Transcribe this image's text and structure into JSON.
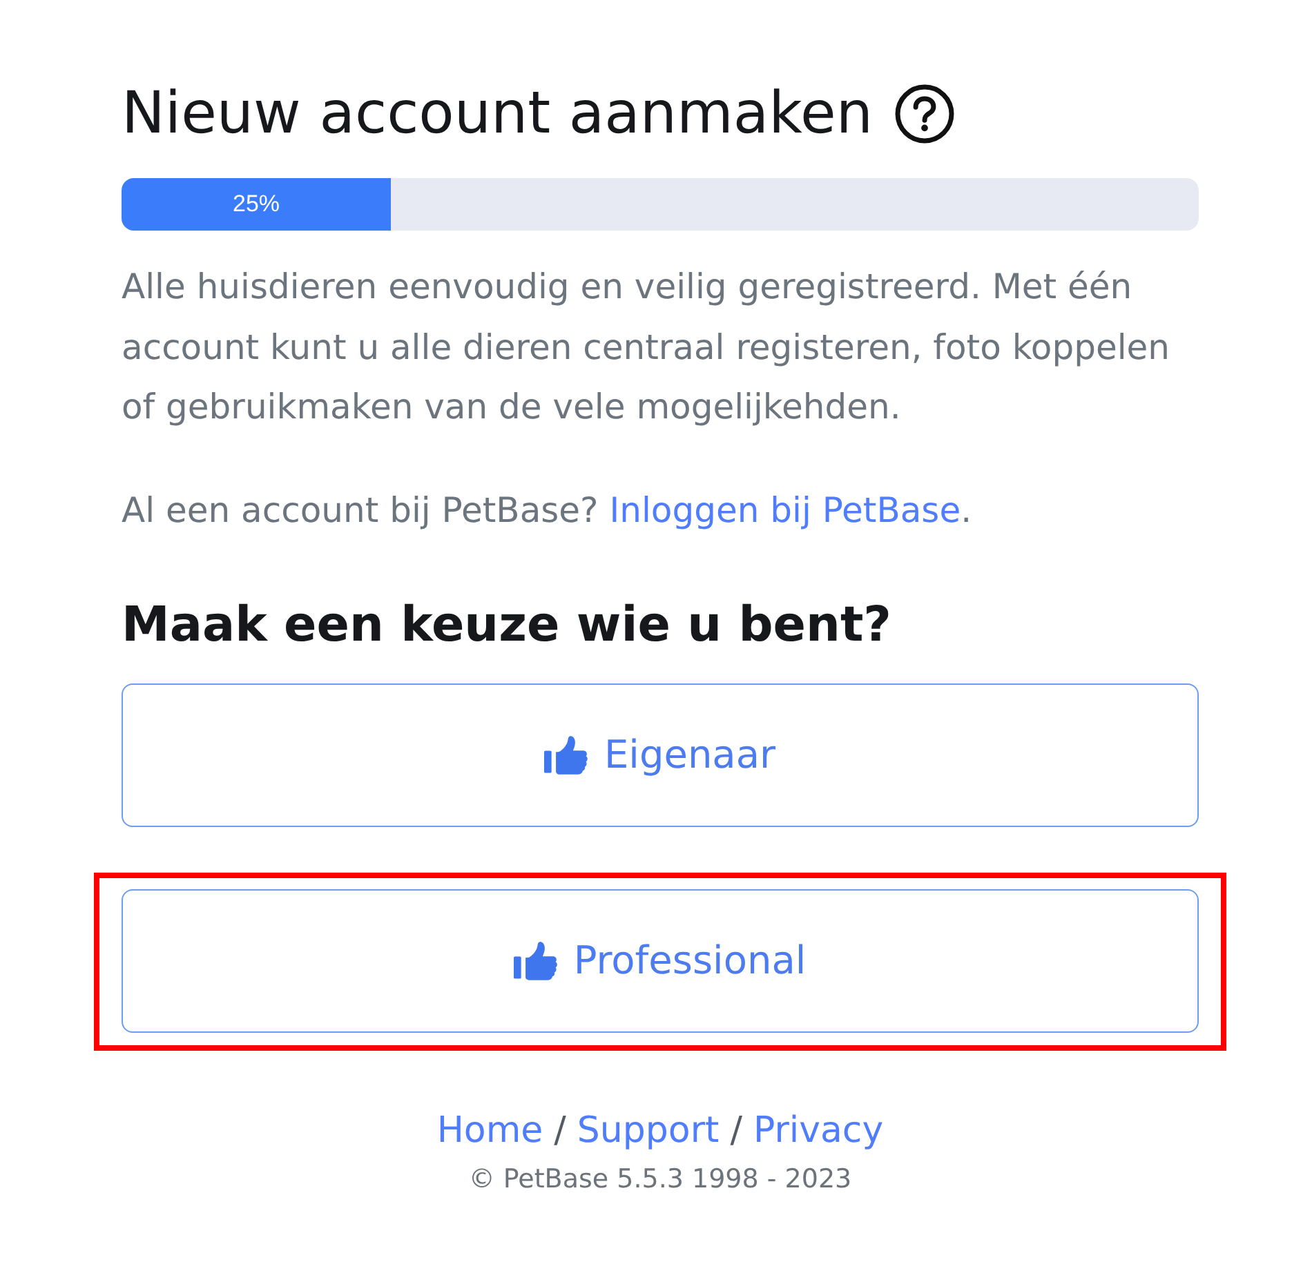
{
  "heading": {
    "title": "Nieuw account aanmaken"
  },
  "progress": {
    "level": 0.25,
    "label": "25%"
  },
  "intro": "Alle huisdieren eenvoudig en veilig geregistreerd. Met één account kunt u alle dieren centraal registeren, foto koppelen of gebruikmaken van de vele mogelijkehden.",
  "login_prompt": {
    "text": "Al een account bij PetBase?",
    "link": "Inloggen bij PetBase",
    "end": "."
  },
  "choice_heading": "Maak een keuze wie u bent?",
  "choices": [
    {
      "label": "Eigenaar",
      "highlighted": false
    },
    {
      "label": "Professional",
      "highlighted": true
    }
  ],
  "footer": {
    "items": [
      {
        "kind": "link",
        "text": "Home"
      },
      {
        "kind": "separator",
        "text": "/"
      },
      {
        "kind": "link",
        "text": "Support"
      },
      {
        "kind": "separator",
        "text": "/"
      },
      {
        "kind": "link",
        "text": "Privacy"
      }
    ],
    "copyright": "© PetBase 5.5.3 1998 - 2023"
  }
}
